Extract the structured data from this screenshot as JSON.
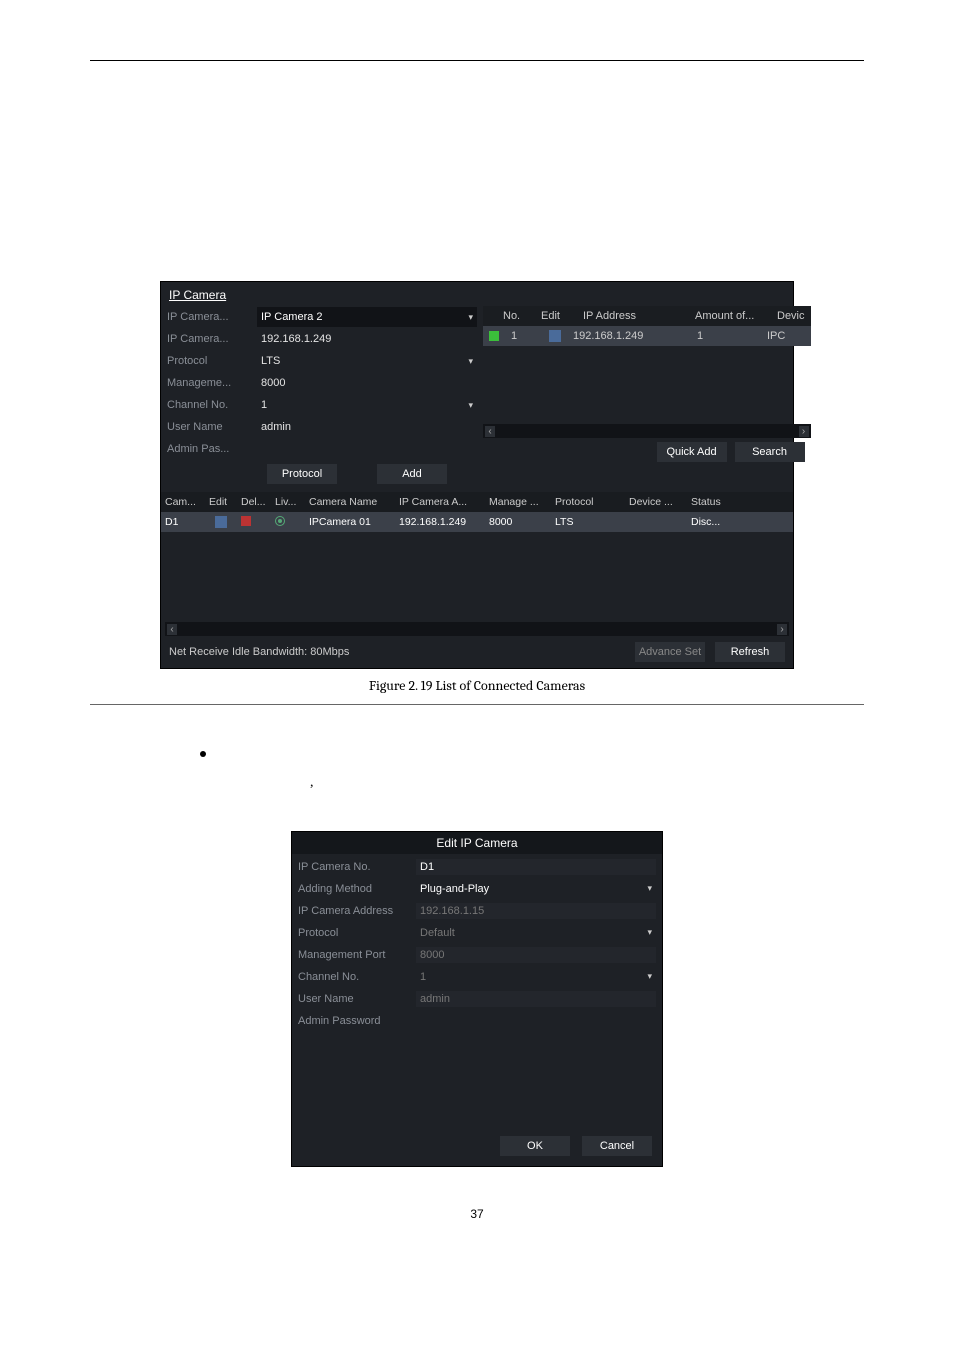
{
  "panel": {
    "title": "IP Camera",
    "form": {
      "cameraNoLabel": "IP Camera...",
      "cameraNoValue": "IP Camera 2",
      "addressLabel": "IP Camera...",
      "addressValue": "192.168.1.249",
      "protocolLabel": "Protocol",
      "protocolValue": "LTS",
      "mgmtLabel": "Manageme...",
      "mgmtValue": "8000",
      "channelLabel": "Channel No.",
      "channelValue": "1",
      "userLabel": "User Name",
      "userValue": "admin",
      "passLabel": "Admin Pas...",
      "passValue": ""
    },
    "rightHead": {
      "no": "No.",
      "edit": "Edit",
      "ip": "IP Address",
      "amount": "Amount of...",
      "device": "Devic"
    },
    "rightRow": {
      "no": "1",
      "ip": "192.168.1.249",
      "amount": "1",
      "device": "IPC"
    },
    "btnProtocol": "Protocol",
    "btnAdd": "Add",
    "btnQuickAdd": "Quick Add",
    "btnSearch": "Search",
    "lowerHead": {
      "cam": "Cam...",
      "edit": "Edit",
      "del": "Del...",
      "liv": "Liv...",
      "name": "Camera Name",
      "ipa": "IP Camera A...",
      "manage": "Manage ...",
      "protocol": "Protocol",
      "device": "Device ...",
      "status": "Status"
    },
    "lowerRow": {
      "cam": "D1",
      "name": "IPCamera 01",
      "ip": "192.168.1.249",
      "port": "8000",
      "protocol": "LTS",
      "status": "Disc..."
    },
    "bandwidth": "Net Receive Idle Bandwidth: 80Mbps",
    "advance": "Advance Set",
    "refresh": "Refresh"
  },
  "caption1": "Figure 2. 19 List of Connected Cameras",
  "dialog": {
    "title": "Edit IP Camera",
    "rows": {
      "noLabel": "IP Camera No.",
      "noValue": "D1",
      "methodLabel": "Adding Method",
      "methodValue": "Plug-and-Play",
      "addrLabel": "IP Camera Address",
      "addrValue": "192.168.1.15",
      "protoLabel": "Protocol",
      "protoValue": "Default",
      "portLabel": "Management Port",
      "portValue": "8000",
      "chLabel": "Channel No.",
      "chValue": "1",
      "userLabel": "User Name",
      "userValue": "admin",
      "passLabel": "Admin Password",
      "passValue": ""
    },
    "ok": "OK",
    "cancel": "Cancel"
  },
  "pageNumber": "37"
}
